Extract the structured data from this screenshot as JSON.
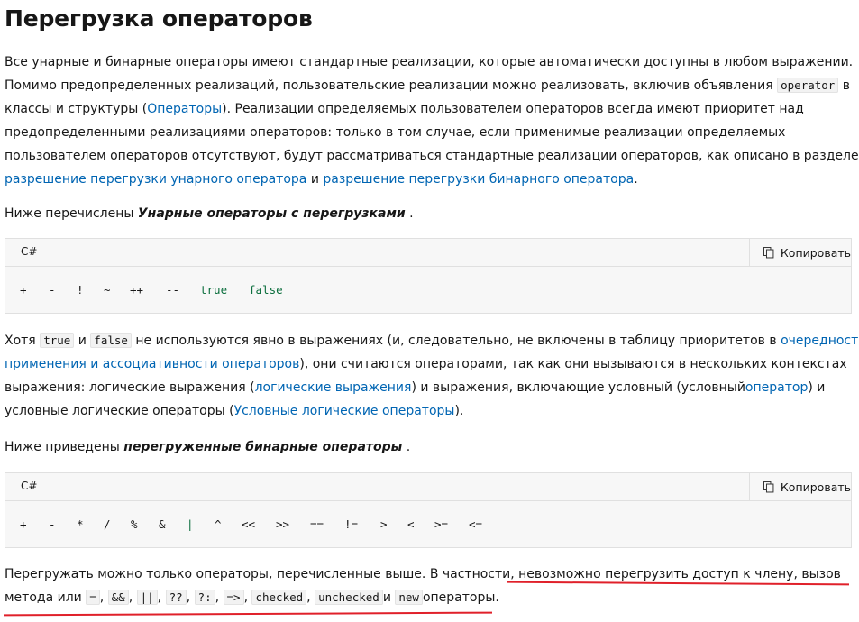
{
  "heading": "Перегрузка операторов",
  "p1": {
    "l1": "Все унарные и бинарные операторы имеют стандартные реализации, которые автоматически доступны в любом выражении.",
    "l2a": "Помимо предопределенных реализаций, пользовательские реализации можно реализовать, включив объявления ",
    "l2code": "operator",
    "l2b": " в",
    "l3a": "классы и структуры (",
    "l3link": "Операторы",
    "l3b": "). Реализации определяемых пользователем операторов всегда имеют приоритет над",
    "l4": "предопределенными реализациями операторов: только в том случае, если применимые реализации определяемых",
    "l5": "пользователем операторов отсутствуют, будут рассматриваться стандартные реализации операторов, как описано в разделе",
    "l6link1": "разрешение перегрузки унарного оператора",
    "l6mid": " и ",
    "l6link2": "разрешение перегрузки бинарного оператора",
    "l6end": "."
  },
  "p2": {
    "pre": "Ниже перечислены ",
    "bold": "Унарные операторы с перегрузками",
    "post": " ."
  },
  "code1": {
    "lang": "C#",
    "copy_label": "Копировать",
    "tokens": [
      "+",
      "-",
      "!",
      "~",
      "++",
      "--",
      "true",
      "false"
    ]
  },
  "p3": {
    "l1a": "Хотя ",
    "l1code1": "true",
    "l1b": " и ",
    "l1code2": "false",
    "l1c": " не используются явно в выражениях (и, следовательно, не включены в таблицу приоритетов в ",
    "l1link": "очередности",
    "l2link": "применения и ассоциативности операторов",
    "l2b": "), они считаются операторами, так как они вызываются в нескольких контекстах",
    "l3a": "выражения: логические выражения (",
    "l3link1": "логические выражения",
    "l3b": ") и выражения, включающие условный (условный",
    "l3link2": "оператор",
    "l3c": ") и",
    "l4a": "условные логические операторы (",
    "l4link": "Условные логические операторы",
    "l4b": ")."
  },
  "p4": {
    "pre": "Ниже приведены ",
    "bold": "перегруженные бинарные операторы",
    "post": " ."
  },
  "code2": {
    "lang": "C#",
    "copy_label": "Копировать",
    "tokens": [
      "+",
      "-",
      "*",
      "/",
      "%",
      "&",
      "|",
      "^",
      "<<",
      ">>",
      "==",
      "!=",
      ">",
      "<",
      ">=",
      "<="
    ]
  },
  "p5": {
    "l1": "Перегружать можно только операторы, перечисленные выше. В частности, невозможно перегрузить доступ к члену, вызов",
    "l2a": "метода или ",
    "c1": "=",
    "s1": ", ",
    "c2": "&&",
    "s2": ", ",
    "c3": "||",
    "s3": ", ",
    "c4": "??",
    "s4": ", ",
    "c5": "?:",
    "s5": ", ",
    "c6": "=>",
    "s6": ", ",
    "c7": "checked",
    "s7": ", ",
    "c8": "unchecked",
    "s8": "и ",
    "c9": "new",
    "l2end": "операторы."
  },
  "colors": {
    "link": "#0065b3",
    "keyword": "#0b6e3d",
    "annotation_underline": "#e0202a"
  }
}
